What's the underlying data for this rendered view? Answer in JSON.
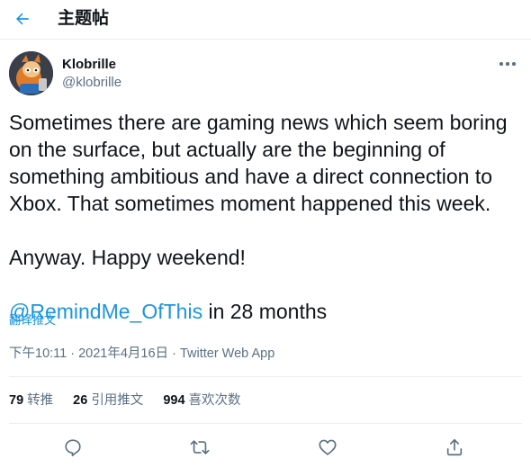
{
  "header": {
    "title": "主题帖",
    "back_icon": "arrow-left-icon"
  },
  "author": {
    "display_name": "Klobrille",
    "handle": "@klobrille"
  },
  "tweet": {
    "paragraph1": "Sometimes there are gaming news which seem boring\non the surface, but actually are the beginning of\nsomething ambitious and have a direct connection to\nXbox. That sometimes moment happened this week.",
    "paragraph2": "Anyway. Happy weekend!",
    "mention": "@RemindMe_OfThis",
    "mention_suffix": " in 28 months",
    "translate_label": "翻译推文"
  },
  "meta": {
    "time": "下午10:11",
    "separator1": " · ",
    "date": "2021年4月16日",
    "separator2": " · ",
    "source": "Twitter Web App"
  },
  "stats": {
    "retweets_count": "79",
    "retweets_label": "转推",
    "quotes_count": "26",
    "quotes_label": "引用推文",
    "likes_count": "994",
    "likes_label": "喜欢次数"
  },
  "actions": [
    "reply-icon",
    "retweet-icon",
    "like-icon",
    "share-icon"
  ],
  "colors": {
    "accent": "#1b95e0",
    "secondary_text": "#5b7083",
    "primary_text": "#0f1419",
    "divider": "#ebeef0"
  }
}
